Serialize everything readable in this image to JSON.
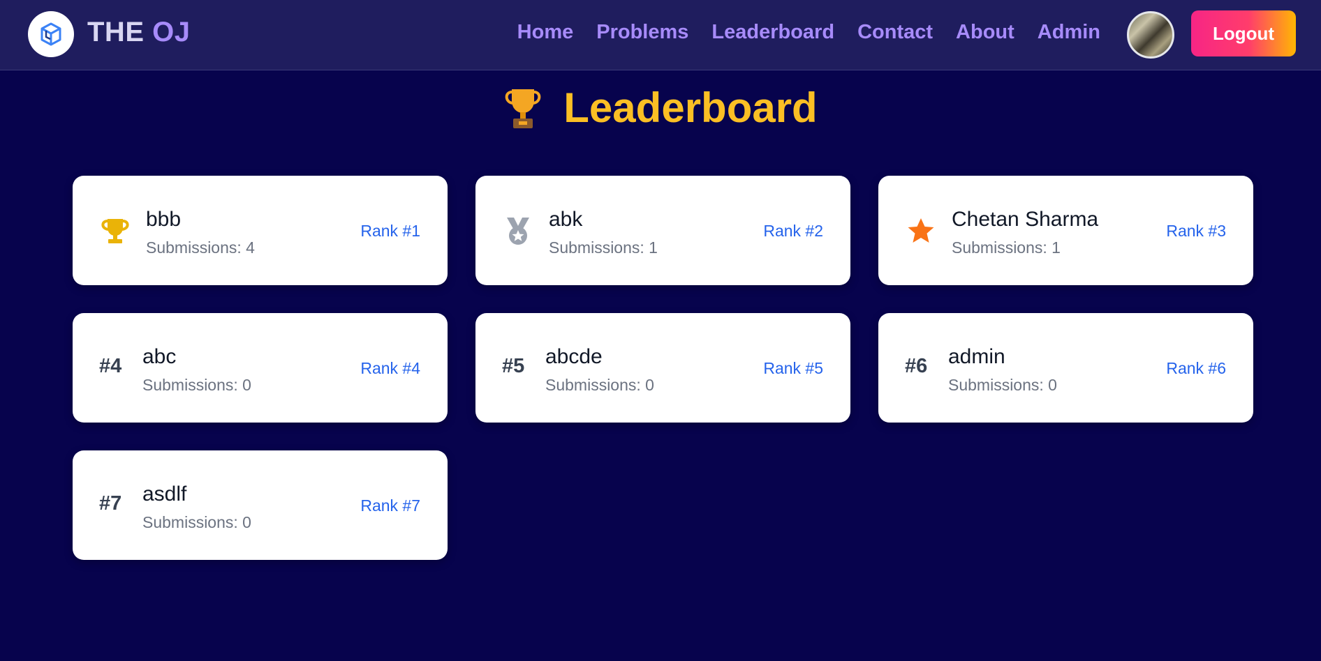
{
  "brand": {
    "prefix": "THE ",
    "accent": "OJ"
  },
  "nav": [
    {
      "label": "Home"
    },
    {
      "label": "Problems"
    },
    {
      "label": "Leaderboard"
    },
    {
      "label": "Contact"
    },
    {
      "label": "About"
    },
    {
      "label": "Admin"
    }
  ],
  "logout_label": "Logout",
  "page": {
    "title": "Leaderboard",
    "title_icon": "trophy-emoji"
  },
  "colors": {
    "background": "#07034d",
    "navbar": "#1f1d5e",
    "accent": "#a78bfa",
    "title": "#fbbf24",
    "rank_link": "#2563eb"
  },
  "leaderboard": [
    {
      "name": "bbb",
      "submissions": "Submissions: 4",
      "rank": "Rank #1",
      "badge": "",
      "icon": "trophy-icon"
    },
    {
      "name": "abk",
      "submissions": "Submissions: 1",
      "rank": "Rank #2",
      "badge": "",
      "icon": "medal-icon"
    },
    {
      "name": "Chetan Sharma",
      "submissions": "Submissions: 1",
      "rank": "Rank #3",
      "badge": "",
      "icon": "star-icon"
    },
    {
      "name": "abc",
      "submissions": "Submissions: 0",
      "rank": "Rank #4",
      "badge": "#4",
      "icon": ""
    },
    {
      "name": "abcde",
      "submissions": "Submissions: 0",
      "rank": "Rank #5",
      "badge": "#5",
      "icon": ""
    },
    {
      "name": "admin",
      "submissions": "Submissions: 0",
      "rank": "Rank #6",
      "badge": "#6",
      "icon": ""
    },
    {
      "name": "asdlf",
      "submissions": "Submissions: 0",
      "rank": "Rank #7",
      "badge": "#7",
      "icon": ""
    }
  ]
}
